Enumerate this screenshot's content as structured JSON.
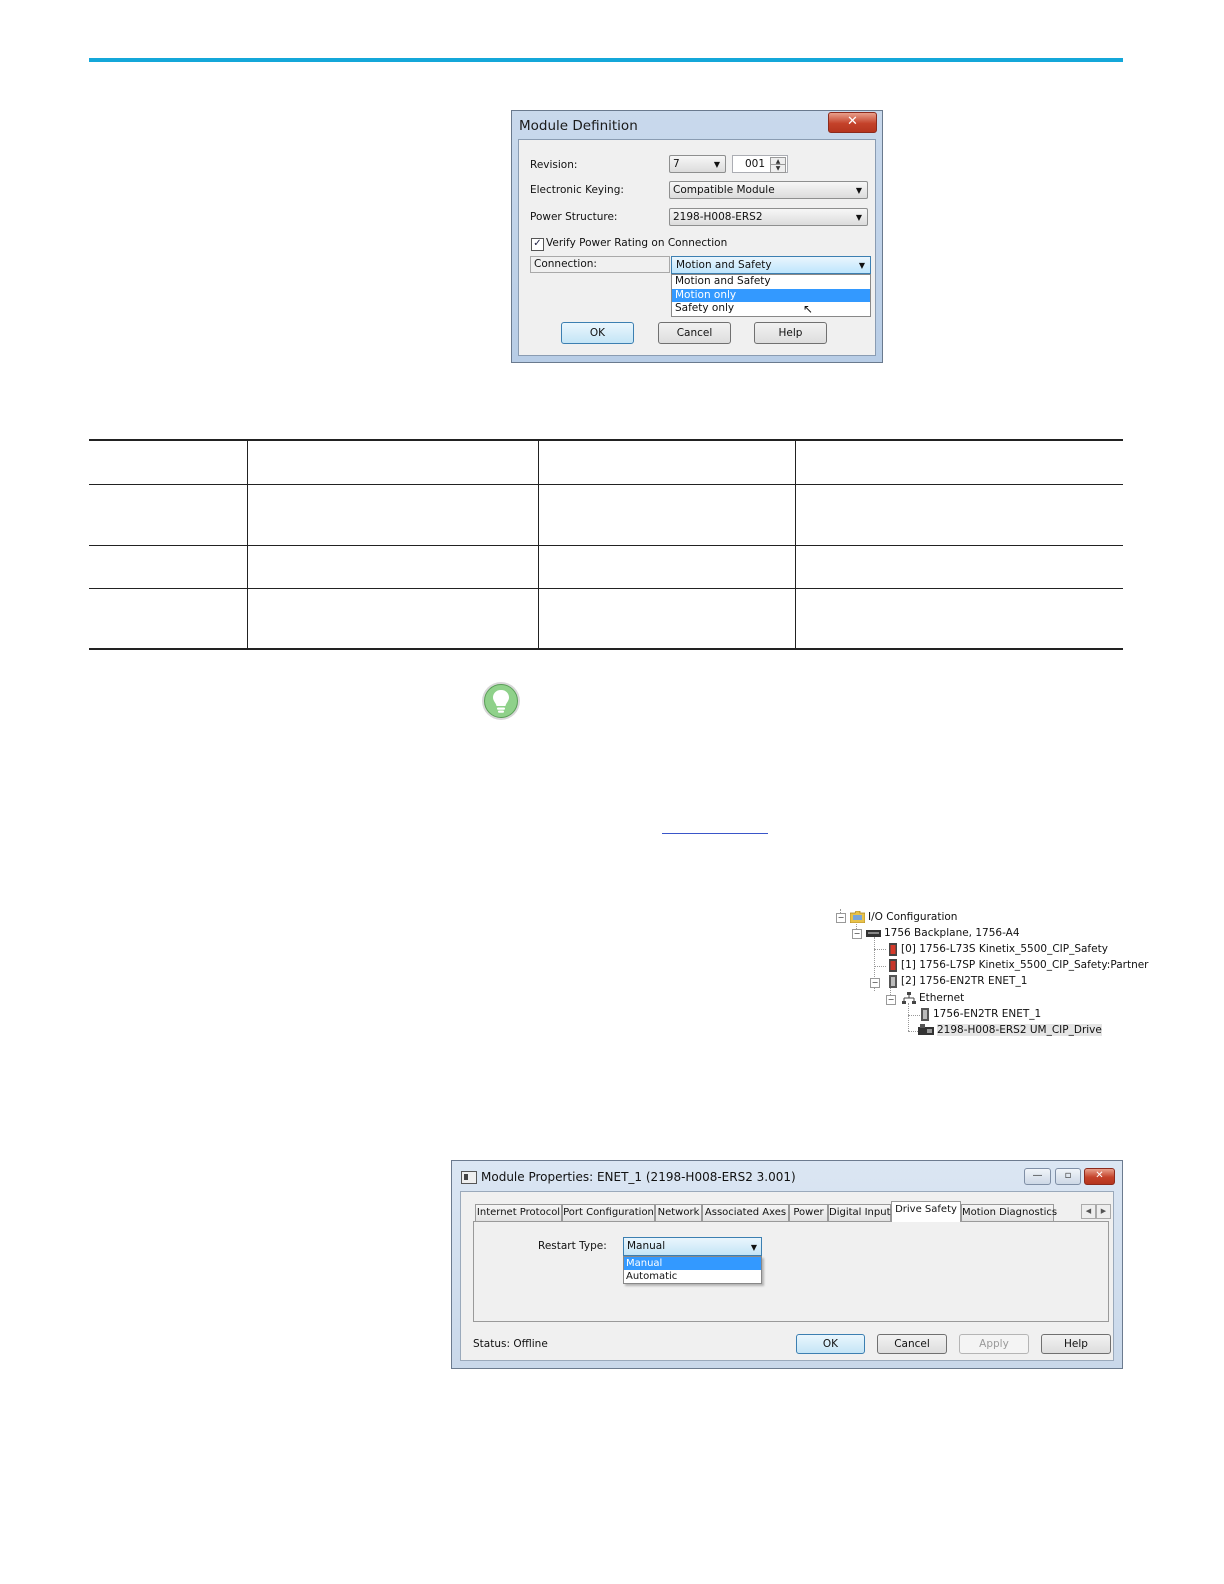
{
  "module_definition": {
    "title": "Module Definition",
    "close_glyph": "✕",
    "revision_label": "Revision:",
    "revision_major": "7",
    "revision_minor": "001",
    "keying_label": "Electronic Keying:",
    "keying_value": "Compatible Module",
    "power_structure_label": "Power Structure:",
    "power_structure_value": "2198-H008-ERS2",
    "verify_label": "Verify Power Rating on Connection",
    "verify_checked": true,
    "connection_label": "Connection:",
    "connection_value": "Motion and Safety",
    "connection_options": [
      "Motion and Safety",
      "Motion only",
      "Safety only"
    ],
    "connection_highlighted": "Motion only",
    "ok_label": "OK",
    "cancel_label": "Cancel",
    "help_label": "Help"
  },
  "io_tree": {
    "items": [
      {
        "label": "I/O Configuration",
        "icon": "folder-icon"
      },
      {
        "label": "1756 Backplane, 1756-A4",
        "icon": "backplane-icon"
      },
      {
        "label": "[0] 1756-L73S Kinetix_5500_CIP_Safety",
        "icon": "safety-controller-icon"
      },
      {
        "label": "[1] 1756-L7SP Kinetix_5500_CIP_Safety:Partner",
        "icon": "safety-partner-icon"
      },
      {
        "label": "[2] 1756-EN2TR ENET_1",
        "icon": "module-icon"
      },
      {
        "label": "Ethernet",
        "icon": "network-icon"
      },
      {
        "label": "1756-EN2TR ENET_1",
        "icon": "module-icon"
      },
      {
        "label": "2198-H008-ERS2 UM_CIP_Drive",
        "icon": "drive-icon"
      }
    ]
  },
  "module_properties": {
    "title": "Module Properties: ENET_1 (2198-H008-ERS2 3.001)",
    "tabs": [
      "Internet Protocol",
      "Port Configuration",
      "Network",
      "Associated Axes",
      "Power",
      "Digital Input",
      "Drive Safety",
      "Motion Diagnostics"
    ],
    "active_tab": "Drive Safety",
    "restart_type_label": "Restart Type:",
    "restart_type_value": "Manual",
    "restart_type_options": [
      "Manual",
      "Automatic"
    ],
    "status_text": "Status:  Offline",
    "ok_label": "OK",
    "cancel_label": "Cancel",
    "apply_label": "Apply",
    "help_label": "Help",
    "minimize_glyph": "—",
    "maximize_glyph": "▫",
    "close_glyph": "✕"
  },
  "colors": {
    "accent_rule": "#14a7d9",
    "selection": "#3399ff",
    "tip_icon": "#8fd18a"
  }
}
